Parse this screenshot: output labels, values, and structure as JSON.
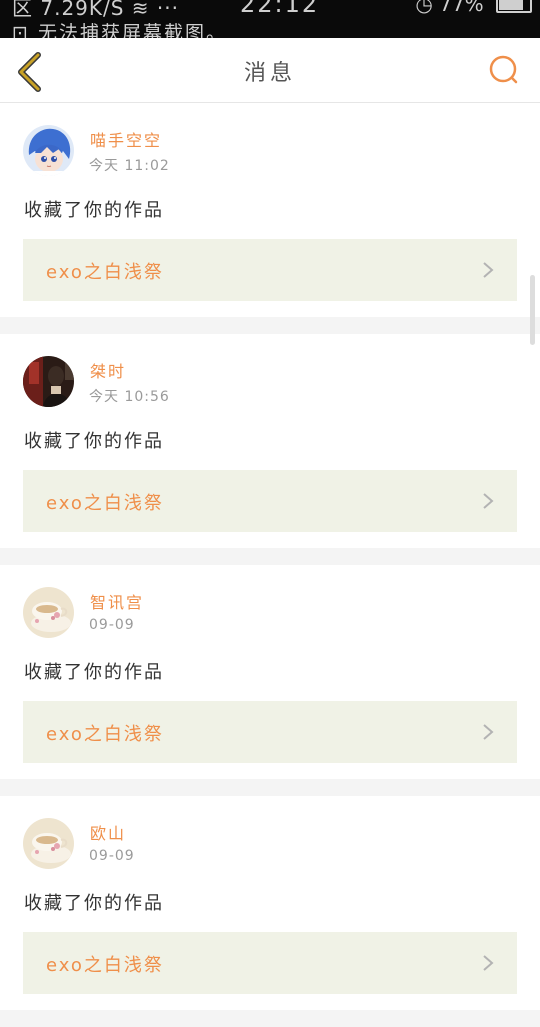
{
  "status_bar": {
    "line1": "区 7.29K/S ≋ ···",
    "line2": "⊡ 无法捕获屏幕截图。",
    "time": "22:12",
    "battery": "77%"
  },
  "header": {
    "title": "消息",
    "back_icon": "chevron-left-icon",
    "search_icon": "search-icon"
  },
  "colors": {
    "accent": "#ef8f4a",
    "back_arrow": "#c9a227",
    "work_bg": "#f0f2e6"
  },
  "messages": [
    {
      "username": "喵手空空",
      "time": "今天 11:02",
      "action": "收藏了你的作品",
      "work_title": "exo之白浅祭",
      "avatar": "anime-avatar"
    },
    {
      "username": "桀时",
      "time": "今天 10:56",
      "action": "收藏了你的作品",
      "work_title": "exo之白浅祭",
      "avatar": "dark-photo-avatar"
    },
    {
      "username": "智讯宫",
      "time": "09-09",
      "action": "收藏了你的作品",
      "work_title": "exo之白浅祭",
      "avatar": "teacup-avatar"
    },
    {
      "username": "欧山",
      "time": "09-09",
      "action": "收藏了你的作品",
      "work_title": "exo之白浅祭",
      "avatar": "teacup-avatar"
    }
  ]
}
